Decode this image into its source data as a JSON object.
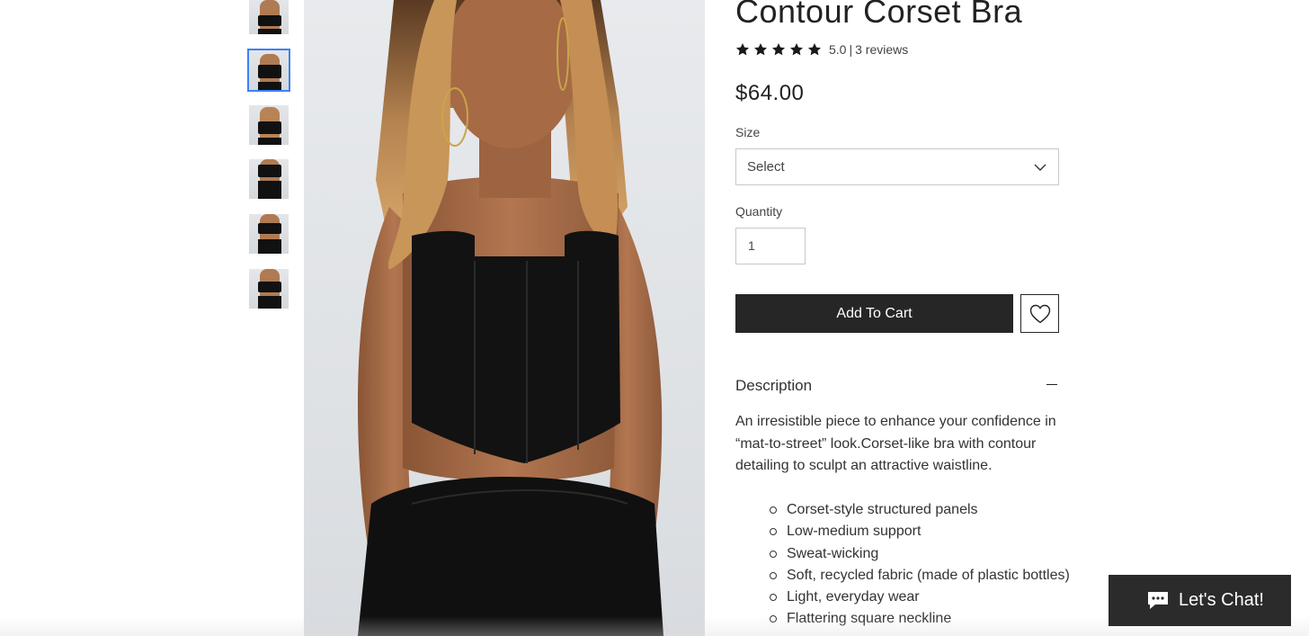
{
  "product": {
    "title": "Contour Corset Bra",
    "rating": {
      "stars": 5,
      "score": "5.0",
      "separator": "|",
      "reviews": "3 reviews"
    },
    "price": "$64.00"
  },
  "options": {
    "size_label": "Size",
    "size_value": "Select",
    "quantity_label": "Quantity",
    "quantity_value": "1"
  },
  "actions": {
    "add_to_cart": "Add To Cart"
  },
  "description": {
    "title": "Description",
    "text": "An irresistible piece to enhance your confidence in “mat-to-street” look.Corset-like bra with contour detailing to sculpt an attractive waistline.",
    "features": [
      "Corset-style structured panels",
      "Low-medium support",
      "Sweat-wicking",
      "Soft, recycled fabric (made of plastic bottles)",
      "Light, everyday wear",
      "Flattering square neckline"
    ]
  },
  "gallery": {
    "thumbnail_count": 6,
    "active_index": 1
  },
  "chat": {
    "label": "Let's Chat!"
  },
  "colors": {
    "button_dark": "#262626",
    "thumb_active": "#3b82f6",
    "star": "#1a1a1a"
  },
  "icons": [
    "star-icon",
    "chevron-down-icon",
    "heart-icon",
    "minus-icon",
    "chat-bubble-icon"
  ]
}
